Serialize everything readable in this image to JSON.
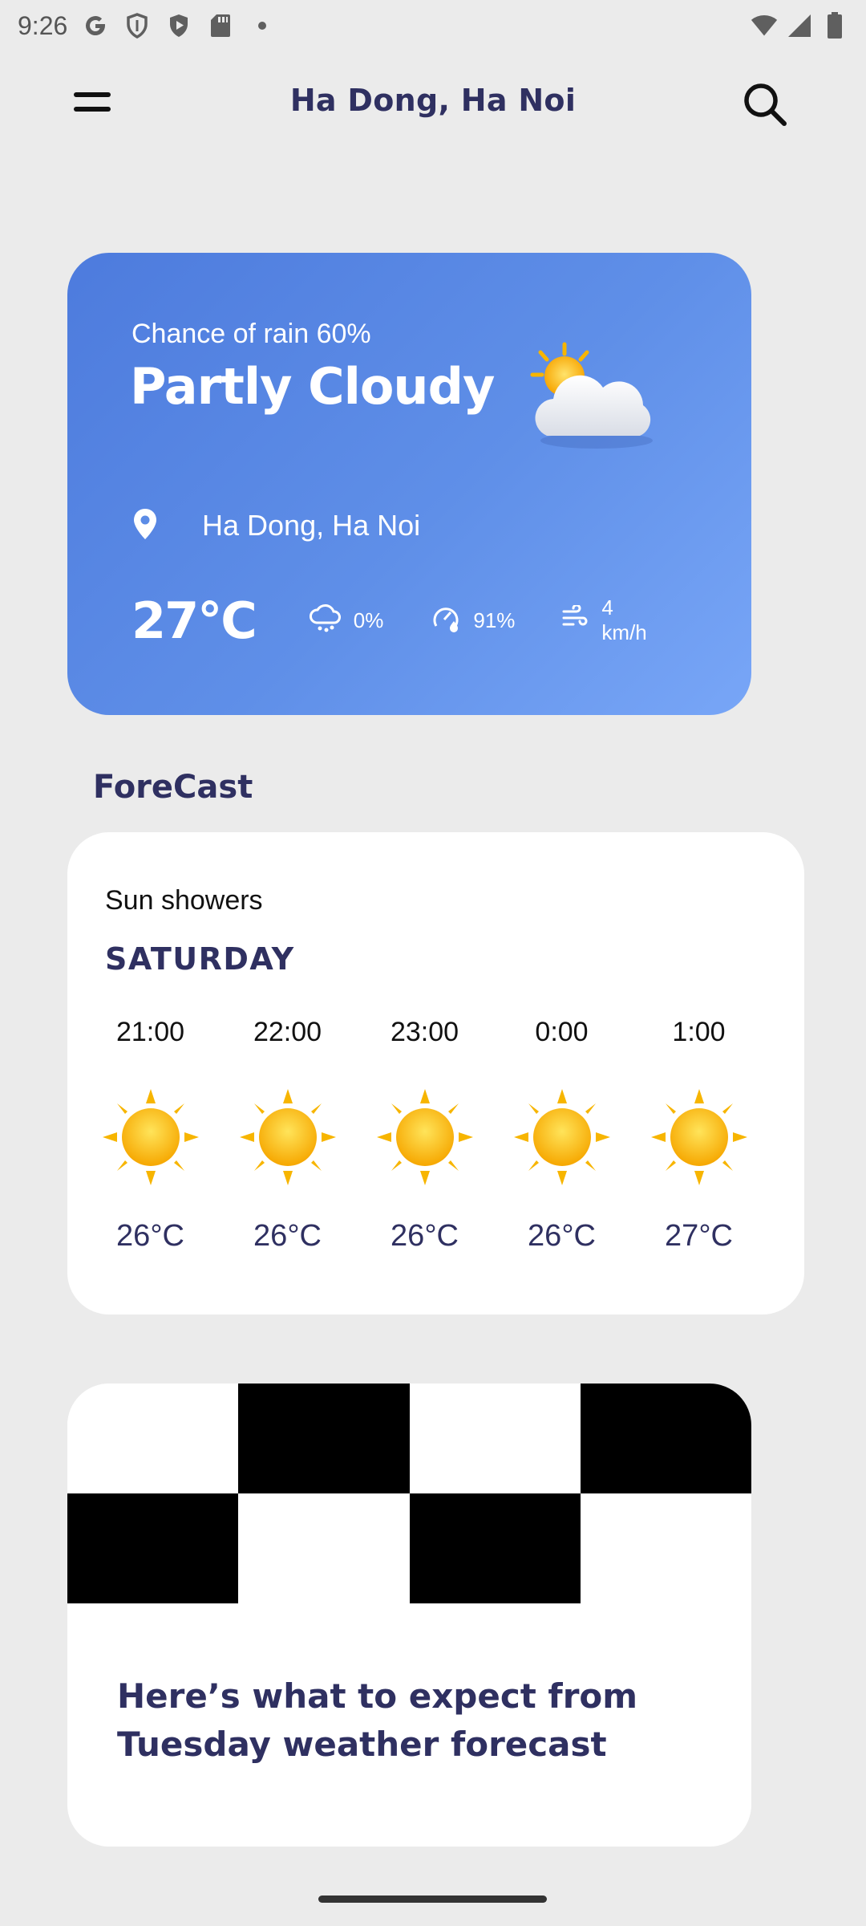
{
  "status_bar": {
    "time": "9:26",
    "left_icons": [
      "google-g-icon",
      "shield-icon",
      "play-shield-icon",
      "sd-card-icon",
      "dot-icon"
    ],
    "right_icons": [
      "wifi-icon",
      "signal-icon",
      "battery-icon"
    ]
  },
  "app_bar": {
    "title": "Ha Dong, Ha Noi",
    "menu_icon": "hamburger-menu-icon",
    "search_icon": "search-icon"
  },
  "current": {
    "rain_chance": "Chance of rain 60%",
    "condition": "Partly Cloudy",
    "location": "Ha Dong, Ha Noi",
    "temperature": "27°C",
    "precip": "0%",
    "humidity": "91%",
    "wind": "4 km/h",
    "colors": {
      "gradient_start": "#4d7bdd",
      "gradient_end": "#78a6f7"
    }
  },
  "forecast": {
    "section_title": "ForeCast",
    "summary": "Sun showers",
    "day": "SATURDAY",
    "hours": [
      {
        "time": "21:00",
        "icon": "sun-icon",
        "temp": "26°C"
      },
      {
        "time": "22:00",
        "icon": "sun-icon",
        "temp": "26°C"
      },
      {
        "time": "23:00",
        "icon": "sun-icon",
        "temp": "26°C"
      },
      {
        "time": "0:00",
        "icon": "sun-icon",
        "temp": "26°C"
      },
      {
        "time": "1:00",
        "icon": "sun-icon",
        "temp": "27°C"
      }
    ]
  },
  "news": {
    "title": "Here’s what to expect from Tuesday weather forecast"
  },
  "colors": {
    "background": "#ebebeb",
    "title_text": "#2f3061",
    "card": "#ffffff"
  }
}
